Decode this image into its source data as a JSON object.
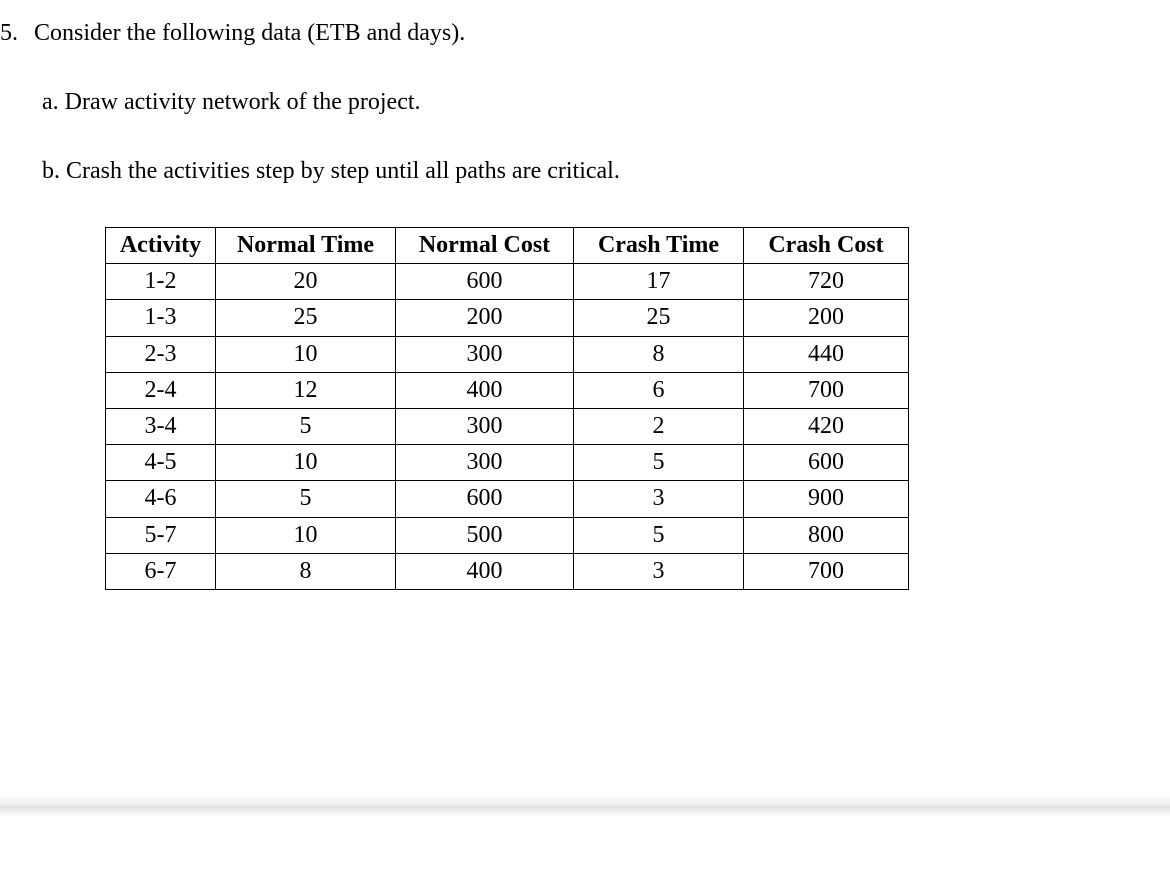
{
  "question": {
    "number": "5.",
    "text": "Consider the following data (ETB and days).",
    "sub_a": "a. Draw activity network of the project.",
    "sub_b": "b. Crash the activities step by step until all paths are critical."
  },
  "table": {
    "headers": {
      "activity": "Activity",
      "normal_time": "Normal Time",
      "normal_cost": "Normal Cost",
      "crash_time": "Crash Time",
      "crash_cost": "Crash Cost"
    },
    "rows": [
      {
        "activity": "1-2",
        "normal_time": "20",
        "normal_cost": "600",
        "crash_time": "17",
        "crash_cost": "720"
      },
      {
        "activity": "1-3",
        "normal_time": "25",
        "normal_cost": "200",
        "crash_time": "25",
        "crash_cost": "200"
      },
      {
        "activity": "2-3",
        "normal_time": "10",
        "normal_cost": "300",
        "crash_time": "8",
        "crash_cost": "440"
      },
      {
        "activity": "2-4",
        "normal_time": "12",
        "normal_cost": "400",
        "crash_time": "6",
        "crash_cost": "700"
      },
      {
        "activity": "3-4",
        "normal_time": "5",
        "normal_cost": "300",
        "crash_time": "2",
        "crash_cost": "420"
      },
      {
        "activity": "4-5",
        "normal_time": "10",
        "normal_cost": "300",
        "crash_time": "5",
        "crash_cost": "600"
      },
      {
        "activity": "4-6",
        "normal_time": "5",
        "normal_cost": "600",
        "crash_time": "3",
        "crash_cost": "900"
      },
      {
        "activity": "5-7",
        "normal_time": "10",
        "normal_cost": "500",
        "crash_time": "5",
        "crash_cost": "800"
      },
      {
        "activity": "6-7",
        "normal_time": "8",
        "normal_cost": "400",
        "crash_time": "3",
        "crash_cost": "700"
      }
    ]
  }
}
